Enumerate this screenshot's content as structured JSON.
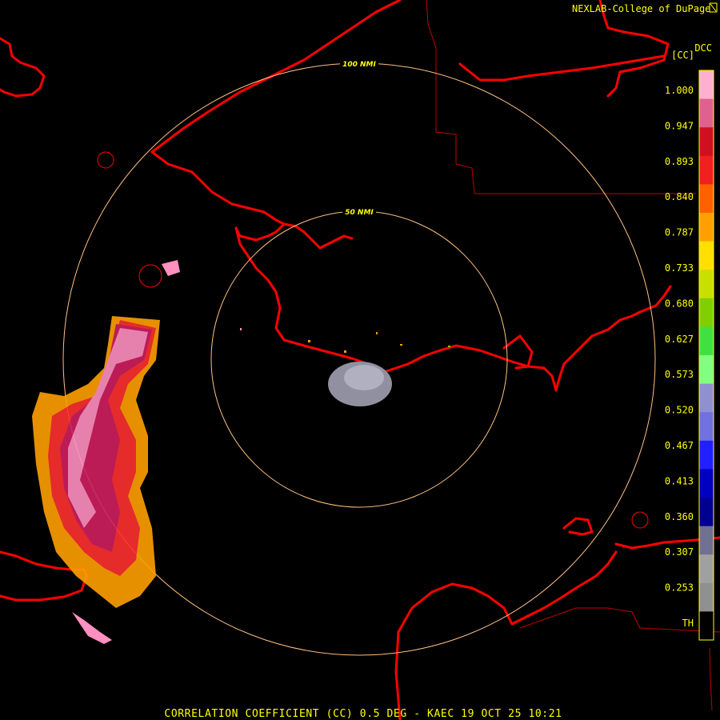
{
  "header": {
    "credit": "NEXLAB-College of DuPage",
    "product_code": "DCC",
    "unit": "[CC]"
  },
  "rings": [
    {
      "label": "100 NMI"
    },
    {
      "label": "50 NMI"
    }
  ],
  "colorbar": {
    "labels": [
      "1.000",
      "0.947",
      "0.893",
      "0.840",
      "0.787",
      "0.733",
      "0.680",
      "0.627",
      "0.573",
      "0.520",
      "0.467",
      "0.413",
      "0.360",
      "0.307",
      "0.253",
      "TH"
    ],
    "colors": [
      "#ffb0d0",
      "#e06090",
      "#d01020",
      "#f02020",
      "#ff6000",
      "#ffa000",
      "#ffe000",
      "#c8e000",
      "#80d000",
      "#40e040",
      "#80ff80",
      "#9090d0",
      "#7070e0",
      "#2020ff",
      "#0000c0",
      "#000090",
      "#707090",
      "#a0a0a0",
      "#909090",
      "#000000"
    ]
  },
  "colors": {
    "map_lines": "#ff0000",
    "range_rings": "#ffc080",
    "text": "#ffff00"
  },
  "footer": {
    "caption": "CORRELATION COEFFICIENT (CC) 0.5 DEG - KAEC 19 OCT 25 10:21"
  }
}
